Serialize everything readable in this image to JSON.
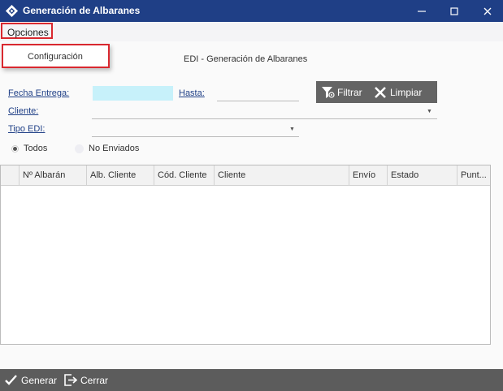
{
  "window": {
    "title": "Generación de Albaranes"
  },
  "menu": {
    "opciones_label": "Opciones",
    "items": [
      "Configuración"
    ]
  },
  "form": {
    "title": "EDI - Generación de Albaranes",
    "fecha_entrega_label": "Fecha Entrega:",
    "hasta_label": "Hasta:",
    "cliente_label": "Cliente:",
    "tipo_edi_label": "Tipo EDI:",
    "fecha_entrega_value": "",
    "hasta_value": "",
    "cliente_value": "",
    "tipo_edi_value": ""
  },
  "toolbar": {
    "filtrar_label": "Filtrar",
    "limpiar_label": "Limpiar"
  },
  "radios": {
    "todos_label": "Todos",
    "no_enviados_label": "No Enviados",
    "selected": "Todos"
  },
  "grid": {
    "columns": [
      "",
      "Nº Albarán",
      "Alb. Cliente",
      "Cód. Cliente",
      "Cliente",
      "Envío",
      "Estado",
      "Punt..."
    ],
    "rows": []
  },
  "footer": {
    "generar_label": "Generar",
    "cerrar_label": "Cerrar"
  },
  "colors": {
    "titlebar": "#1f3f86",
    "highlight": "#d9282f",
    "date_field": "#c7f1fa",
    "toolbar": "#646464",
    "footer": "#5c5c5c"
  }
}
